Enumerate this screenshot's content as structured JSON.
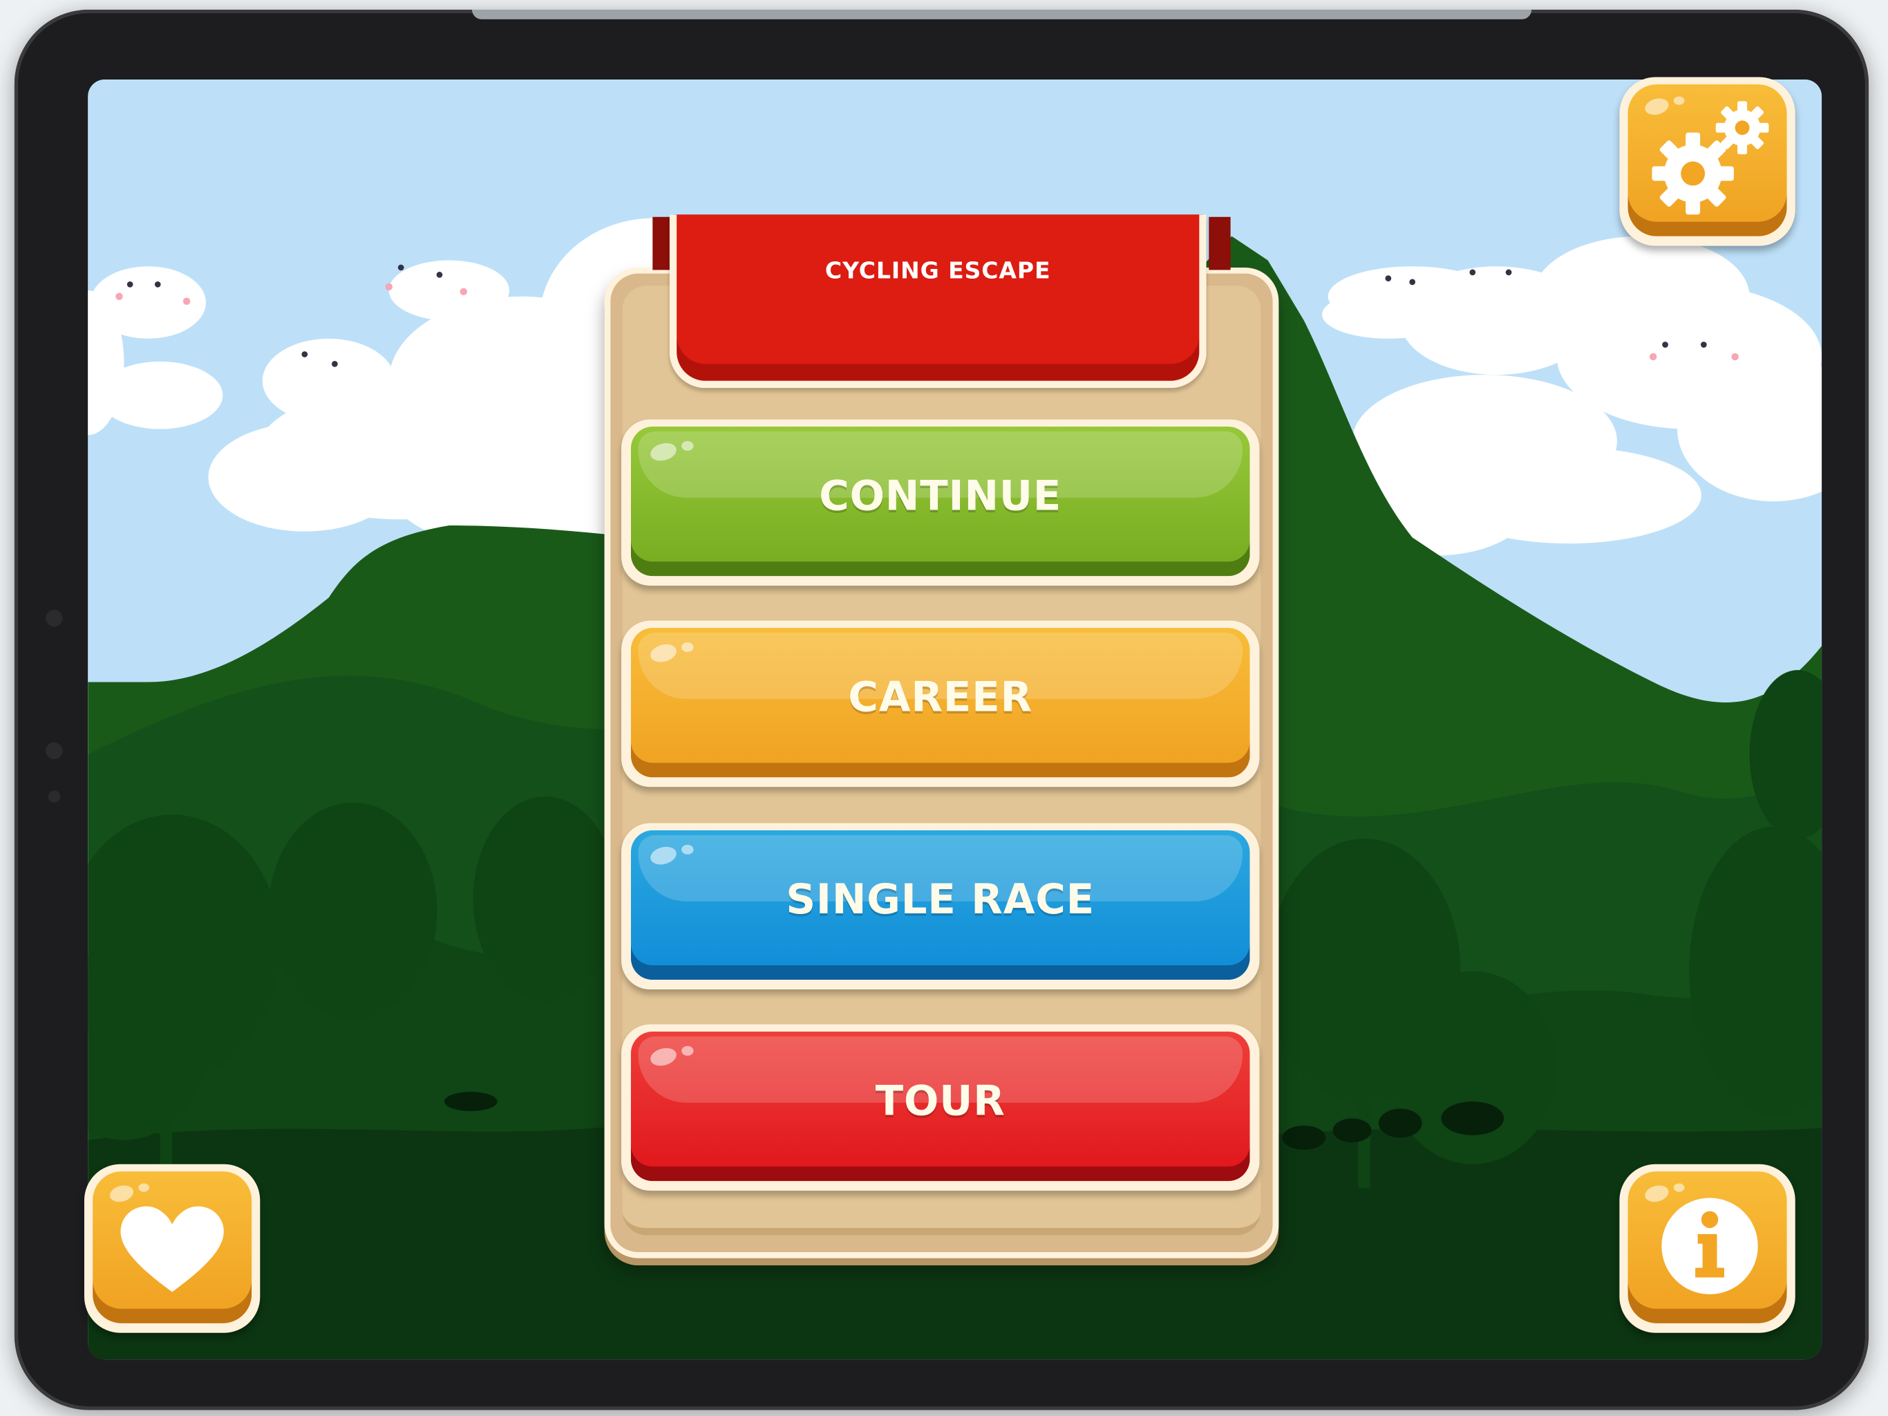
{
  "app": {
    "title": "CYCLING ESCAPE"
  },
  "menu": {
    "items": [
      {
        "label": "CONTINUE",
        "color": "#7ab12a"
      },
      {
        "label": "CAREER",
        "color": "#f4a925"
      },
      {
        "label": "SINGLE RACE",
        "color": "#1498da"
      },
      {
        "label": "TOUR",
        "color": "#e4221f"
      }
    ]
  },
  "corner_buttons": {
    "settings": {
      "icon": "gears-icon"
    },
    "favorite": {
      "icon": "heart-icon"
    },
    "info": {
      "icon": "info-icon"
    }
  },
  "theme": {
    "sky": "#b9def7",
    "hill": "#1a5a19",
    "panel": "#d9b98c",
    "banner": "#dd1c12",
    "accent_orange": "#f4a925"
  }
}
